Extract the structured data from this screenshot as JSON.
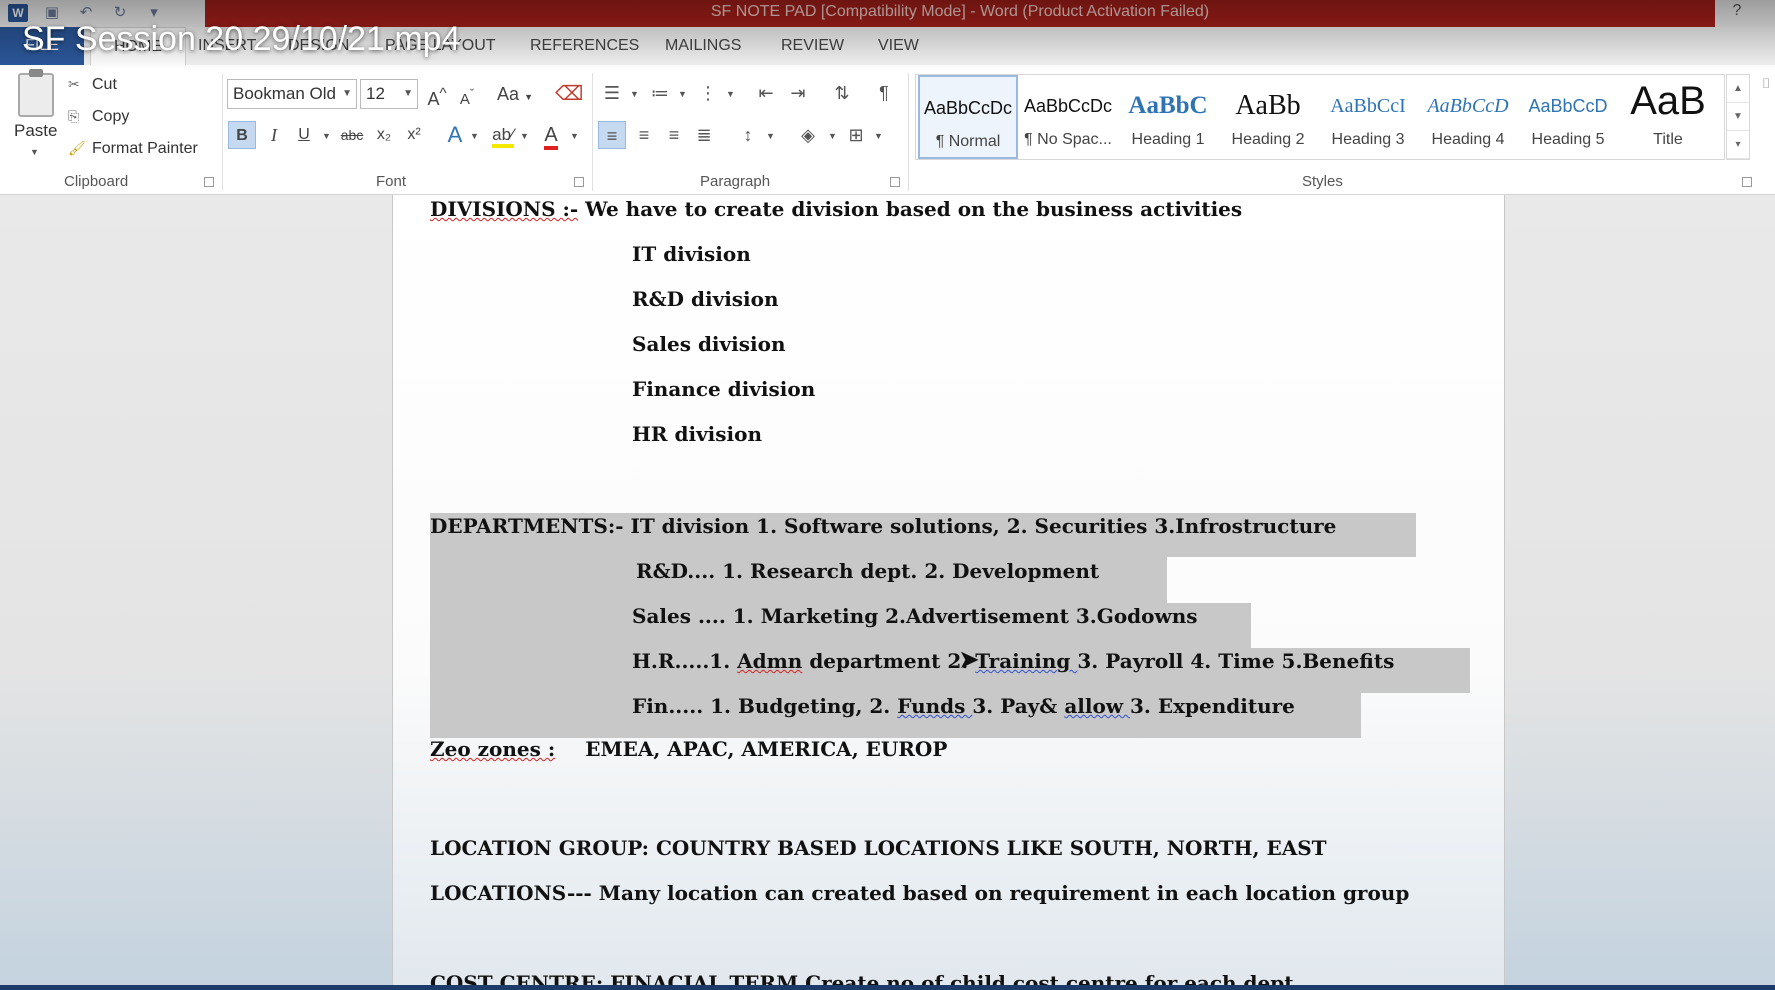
{
  "window": {
    "title": "SF NOTE PAD [Compatibility Mode] -  Word (Product Activation Failed)",
    "help": "?"
  },
  "video_overlay": {
    "title": "SF Session 20 29/10/21.mp4"
  },
  "quick_access": {
    "word_logo": "W",
    "save_icon": "save-icon",
    "undo_icon": "undo-icon",
    "redo_icon": "redo-icon",
    "customize_icon": "customize-icon"
  },
  "ribbon_tabs": [
    "FILE",
    "HOME",
    "INSERT",
    "DESIGN",
    "PAGE LAYOUT",
    "REFERENCES",
    "MAILINGS",
    "REVIEW",
    "VIEW"
  ],
  "clipboard": {
    "paste": "Paste",
    "cut": "Cut",
    "copy": "Copy",
    "format_painter": "Format Painter",
    "group_label": "Clipboard"
  },
  "font": {
    "name": "Bookman Old",
    "size": "12",
    "group_label": "Font",
    "case_label": "Aa",
    "bold": "B",
    "italic": "I",
    "underline": "U",
    "strike": "abc",
    "sub": "x₂",
    "sup": "x²",
    "effects": "A",
    "color": "A",
    "grow": "A",
    "shrink": "A"
  },
  "paragraph": {
    "group_label": "Paragraph",
    "pilcrow": "¶"
  },
  "styles": {
    "group_label": "Styles",
    "items": [
      {
        "preview": "AaBbCcDc",
        "name": "¶ Normal"
      },
      {
        "preview": "AaBbCcDc",
        "name": "¶ No Spac..."
      },
      {
        "preview": "AaBbC",
        "name": "Heading 1"
      },
      {
        "preview": "AaBb",
        "name": "Heading 2"
      },
      {
        "preview": "AaBbCcI",
        "name": "Heading 3"
      },
      {
        "preview": "AaBbCcD",
        "name": "Heading 4"
      },
      {
        "preview": "AaBbCcD",
        "name": "Heading 5"
      },
      {
        "preview": "AaB",
        "name": "Title"
      }
    ],
    "colors": {
      "heading_blue": "#2e74b5",
      "title_black": "#111111"
    }
  },
  "document": {
    "divisions_label": "DIVISIONS :-",
    "divisions_text": " We have to create division based on the business activities",
    "divisions": [
      "IT division",
      "R&D division",
      "Sales division",
      "Finance division",
      "HR division"
    ],
    "departments": {
      "label": "DEPARTMENTS:-",
      "it": " IT division 1. Software solutions, 2. Securities   3.Infrostructure",
      "rnd": "R&D.... 1. Research dept.   2. Development",
      "sales": "Sales .... 1. Marketing 2.Advertisement 3.Godowns",
      "hr_a": "H.R.....1. ",
      "hr_admn": "Admn",
      "hr_b": " department 2. ",
      "hr_training": "Training ",
      "hr_c": " 3. Payroll 4. Time 5.Benefits",
      "fin_a": "Fin..... 1. Budgeting, 2. ",
      "fin_funds": "Funds ",
      "fin_b": " 3. Pay& ",
      "fin_allow": "allow ",
      "fin_c": " 3. Expenditure"
    },
    "zeo_label": "Zeo zones :",
    "zeo_text": "EMEA, APAC, AMERICA, EUROP",
    "location_group": "LOCATION GROUP:  COUNTRY BASED LOCATIONS LIKE SOUTH, NORTH, EAST",
    "locations": "LOCATIONS--- Many location can created based on requirement in each location group",
    "cost_centre": "COST CENTRE: FINACIAL TERM  Create no of child cost centre for each dept"
  }
}
